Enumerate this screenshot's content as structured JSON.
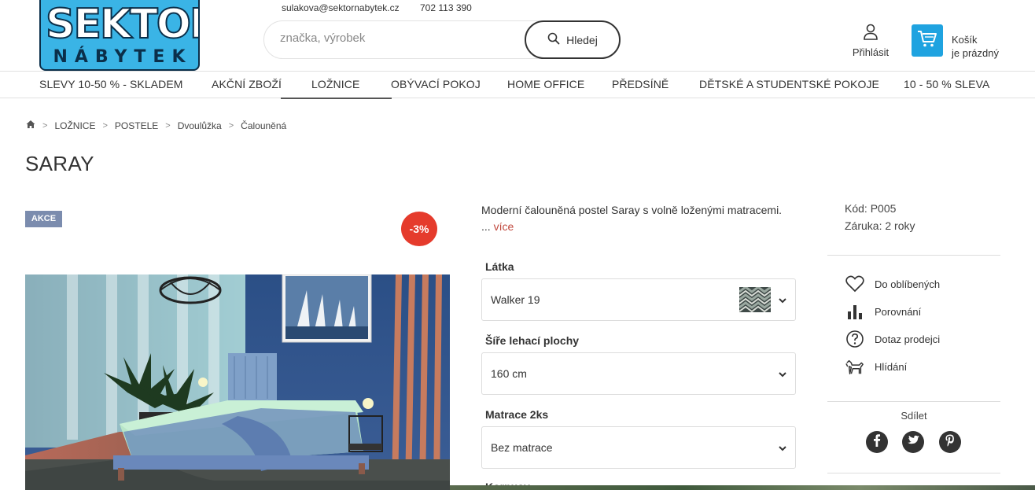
{
  "header": {
    "logo_line1": "SEKTOR",
    "logo_line2": "NÁBYTEK",
    "email": "sulakova@sektornabytek.cz",
    "phone": "702 113 390",
    "search_placeholder": "značka, výrobek",
    "search_button": "Hledej",
    "login_label": "Přihlásit",
    "cart_line1": "Košík",
    "cart_line2": "je prázdný"
  },
  "nav": {
    "items": [
      {
        "label": "SLEVY 10-50 % - SKLADEM"
      },
      {
        "label": "AKČNÍ ZBOŽÍ"
      },
      {
        "label": "LOŽNICE",
        "active": true
      },
      {
        "label": "OBÝVACÍ POKOJ"
      },
      {
        "label": "HOME OFFICE"
      },
      {
        "label": "PŘEDSÍNĚ"
      },
      {
        "label": "DĚTSKÉ A STUDENTSKÉ POKOJE"
      },
      {
        "label": "10 - 50 % SLEVA"
      }
    ]
  },
  "breadcrumb": {
    "home_icon": "home-icon",
    "items": [
      "LOŽNICE",
      "POSTELE",
      "Dvoulůžka",
      "Čalouněná"
    ],
    "separator": ">"
  },
  "product": {
    "title": "SARAY",
    "badge_sale": "AKCE",
    "badge_discount": "-3%",
    "description": "Moderní čalouněná postel Saray s volně loženými matracemi.",
    "more_prefix": "...",
    "more_link": "více",
    "options": [
      {
        "label": "Látka",
        "value": "Walker 19"
      },
      {
        "label": "Šíře lehací plochy",
        "value": "160 cm"
      },
      {
        "label": "Matrace 2ks",
        "value": "Bez matrace"
      },
      {
        "label": "Korpusy"
      }
    ],
    "code": "Kód: P005",
    "warranty": "Záruka: 2 roky",
    "actions": [
      {
        "label": "Do oblíbených",
        "icon": "heart-icon"
      },
      {
        "label": "Porovnání",
        "icon": "bar-chart-icon"
      },
      {
        "label": "Dotaz prodejci",
        "icon": "question-icon"
      },
      {
        "label": "Hlídání",
        "icon": "dog-icon"
      }
    ],
    "share_label": "Sdílet",
    "share": [
      "facebook-icon",
      "twitter-icon",
      "pinterest-icon"
    ]
  },
  "colors": {
    "brand_blue": "#3ab4e6",
    "cart_blue": "#1fa3e0",
    "discount_red": "#e53b2c",
    "badge_gray_blue": "#7b8cae",
    "link_red": "#c0473c"
  }
}
